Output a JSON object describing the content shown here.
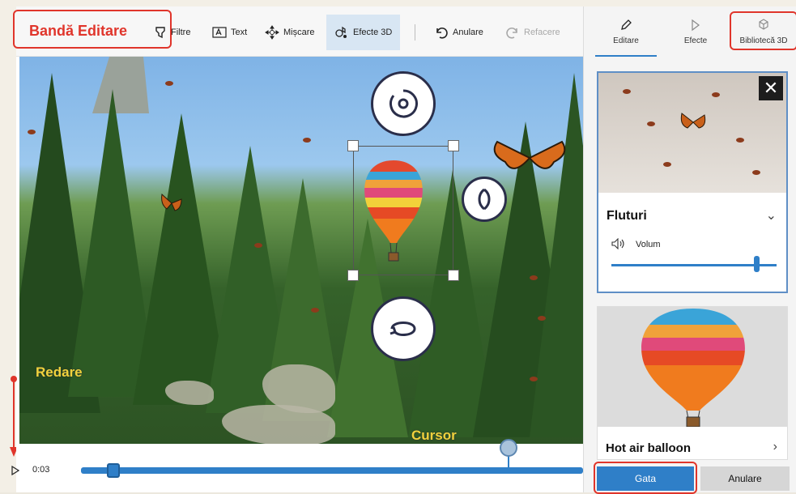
{
  "toolbar": {
    "title": "Bandă Editare",
    "items": [
      {
        "label": "Filtre",
        "icon": "filter-icon"
      },
      {
        "label": "Text",
        "icon": "text-icon"
      },
      {
        "label": "Mișcare",
        "icon": "motion-icon"
      },
      {
        "label": "Efecte 3D",
        "icon": "3d-effects-icon"
      },
      {
        "label": "Anulare",
        "icon": "undo-icon"
      },
      {
        "label": "Refacere",
        "icon": "redo-icon"
      }
    ]
  },
  "canvas": {
    "annotations": {
      "play_label": "Redare",
      "cursor_label": "Cursor"
    }
  },
  "timeline": {
    "time": "0:03"
  },
  "panel": {
    "tabs": [
      {
        "label": "Editare",
        "icon": "pencil-icon"
      },
      {
        "label": "Efecte",
        "icon": "effects-icon"
      },
      {
        "label": "Bibliotecă 3D",
        "icon": "3d-library-icon"
      }
    ],
    "cards": [
      {
        "title": "Fluturi",
        "volume_label": "Volum",
        "volume_level": 0.88
      },
      {
        "title": "Hot air balloon"
      }
    ],
    "buttons": {
      "done": "Gata",
      "cancel": "Anulare"
    }
  },
  "colors": {
    "accent": "#2f7fc8",
    "callout": "#e0352b",
    "annotation": "#f0d23c"
  }
}
